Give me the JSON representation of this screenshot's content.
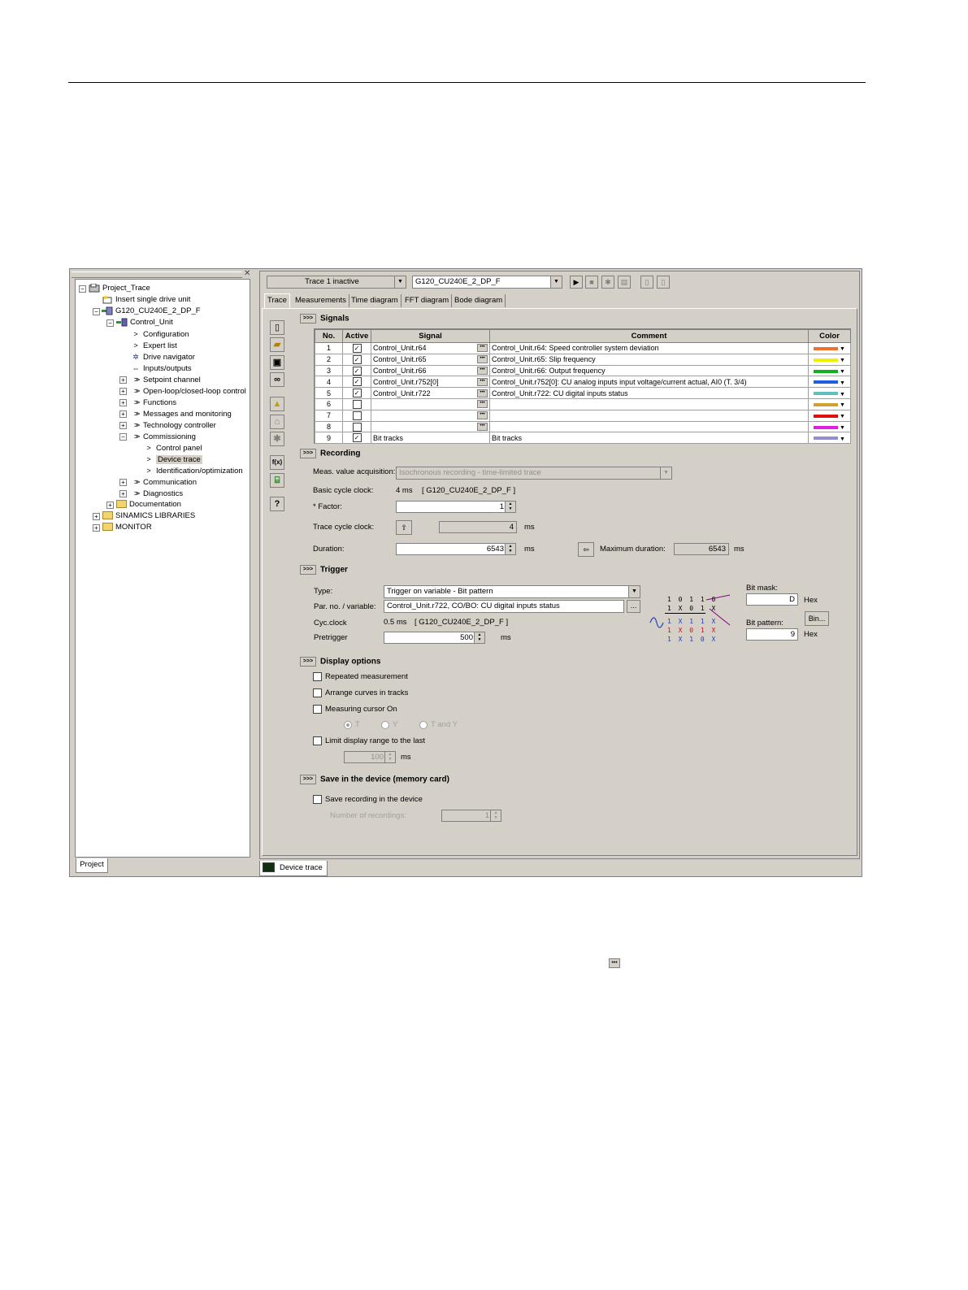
{
  "tree": {
    "items": [
      {
        "label": "Project_Trace"
      },
      {
        "label": "Insert single drive unit"
      },
      {
        "label": "G120_CU240E_2_DP_F"
      },
      {
        "label": "Control_Unit"
      },
      {
        "label": "Configuration"
      },
      {
        "label": "Expert list"
      },
      {
        "label": "Drive navigator"
      },
      {
        "label": "Inputs/outputs"
      },
      {
        "label": "Setpoint channel"
      },
      {
        "label": "Open-loop/closed-loop control"
      },
      {
        "label": "Functions"
      },
      {
        "label": "Messages and monitoring"
      },
      {
        "label": "Technology controller"
      },
      {
        "label": "Commissioning"
      },
      {
        "label": "Control panel"
      },
      {
        "label": "Device trace"
      },
      {
        "label": "Identification/optimization"
      },
      {
        "label": "Communication"
      },
      {
        "label": "Diagnostics"
      },
      {
        "label": "Documentation"
      },
      {
        "label": "SINAMICS LIBRARIES"
      },
      {
        "label": "MONITOR"
      }
    ],
    "project_tab": "Project"
  },
  "toolbar": {
    "trace_select": "Trace 1 inactive",
    "device_select": "G120_CU240E_2_DP_F"
  },
  "tabs": [
    "Trace",
    "Measurements",
    "Time diagram",
    "FFT diagram",
    "Bode diagram"
  ],
  "signals": {
    "heading": "Signals",
    "headers": {
      "no": "No.",
      "active": "Active",
      "signal": "Signal",
      "comment": "Comment",
      "color": "Color"
    },
    "rows": [
      {
        "no": "1",
        "active": true,
        "signal": "Control_Unit.r64",
        "comment": "Control_Unit.r64: Speed controller system deviation",
        "color": "#f07030"
      },
      {
        "no": "2",
        "active": true,
        "signal": "Control_Unit.r65",
        "comment": "Control_Unit.r65: Slip frequency",
        "color": "#f0f000"
      },
      {
        "no": "3",
        "active": true,
        "signal": "Control_Unit.r66",
        "comment": "Control_Unit.r66: Output frequency",
        "color": "#10b020"
      },
      {
        "no": "4",
        "active": true,
        "signal": "Control_Unit.r752[0]",
        "comment": "Control_Unit.r752[0]: CU analog inputs input voltage/current actual, AI0 (T. 3/4)",
        "color": "#2060e0"
      },
      {
        "no": "5",
        "active": true,
        "signal": "Control_Unit.r722",
        "comment": "Control_Unit.r722: CU digital inputs status",
        "color": "#60c0c0"
      },
      {
        "no": "6",
        "active": false,
        "signal": "",
        "comment": "",
        "color": "#d0a030"
      },
      {
        "no": "7",
        "active": false,
        "signal": "",
        "comment": "",
        "color": "#e01010"
      },
      {
        "no": "8",
        "active": false,
        "signal": "",
        "comment": "",
        "color": "#e020e0"
      },
      {
        "no": "9",
        "active": true,
        "signal": "Bit tracks",
        "comment": "Bit tracks",
        "color": "#9090d0"
      }
    ]
  },
  "recording": {
    "heading": "Recording",
    "acq_label": "Meas. value acquisition:",
    "acq_value": "Isochronous recording - time-limited trace",
    "basic_clock_label": "Basic cycle clock:",
    "basic_clock_value": "4 ms",
    "basic_clock_device": "[ G120_CU240E_2_DP_F ]",
    "factor_label": "* Factor:",
    "factor_value": "1",
    "trace_clock_label": "Trace cycle clock:",
    "trace_clock_value": "4",
    "trace_clock_unit": "ms",
    "duration_label": "Duration:",
    "duration_value": "6543",
    "duration_unit": "ms",
    "max_duration_label": "Maximum duration:",
    "max_duration_value": "6543",
    "max_duration_unit": "ms"
  },
  "trigger": {
    "heading": "Trigger",
    "type_label": "Type:",
    "type_value": "Trigger on variable - Bit pattern",
    "par_label": "Par. no. / variable:",
    "par_value": "Control_Unit.r722, CO/BO: CU digital inputs status",
    "cyc_label": "Cyc.clock",
    "cyc_value": "0.5 ms",
    "cyc_device": "[ G120_CU240E_2_DP_F ]",
    "pretrigger_label": "Pretrigger",
    "pretrigger_value": "500",
    "pretrigger_unit": "ms",
    "bit_mask_label": "Bit mask:",
    "bit_mask_value": "D",
    "bit_mask_unit": "Hex",
    "bit_pattern_label": "Bit pattern:",
    "bit_pattern_value": "9",
    "bit_pattern_unit": "Hex",
    "bin_button": "Bin...",
    "bits_row1": "1 0 1 1 0",
    "bits_row2": "1 X 0 1 X",
    "bits_row3": "1 X 1 1 X",
    "bits_row4": "1 X 0 1 X",
    "bits_row5": "1 X 1 0 X"
  },
  "display": {
    "heading": "Display options",
    "repeated": "Repeated measurement",
    "arrange": "Arrange curves in tracks",
    "cursor": "Measuring cursor On",
    "radio_t": "T",
    "radio_y": "Y",
    "radio_ty": "T and Y",
    "limit": "Limit display range to the last",
    "limit_value": "100",
    "limit_unit": "ms"
  },
  "save": {
    "heading": "Save in the device (memory card)",
    "save_recording": "Save recording in the device",
    "num_label": "Number of recordings:",
    "num_value": "1"
  },
  "status_tab": "Device trace",
  "colors": {
    "window_bg": "#d4d0c8",
    "accent_purple": "#800080"
  }
}
